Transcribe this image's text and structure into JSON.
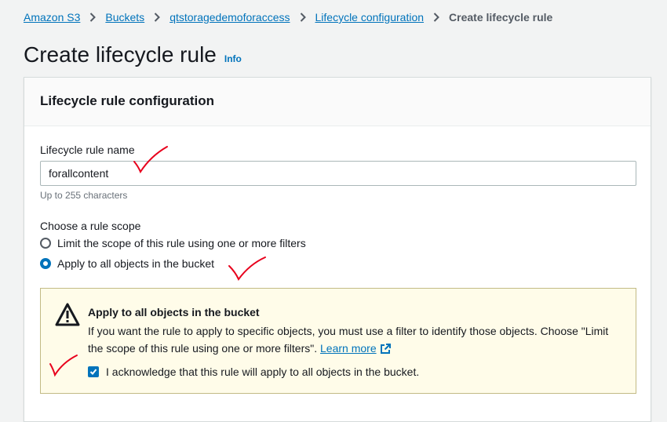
{
  "breadcrumb": {
    "items": [
      "Amazon S3",
      "Buckets",
      "qtstoragedemoforaccess",
      "Lifecycle configuration"
    ],
    "current": "Create lifecycle rule"
  },
  "page": {
    "title": "Create lifecycle rule",
    "info_label": "Info"
  },
  "panel": {
    "title": "Lifecycle rule configuration",
    "rule_name_label": "Lifecycle rule name",
    "rule_name_value": "forallcontent",
    "rule_name_hint": "Up to 255 characters",
    "scope_label": "Choose a rule scope",
    "scope_options": [
      {
        "label": "Limit the scope of this rule using one or more filters",
        "selected": false
      },
      {
        "label": "Apply to all objects in the bucket",
        "selected": true
      }
    ]
  },
  "alert": {
    "title": "Apply to all objects in the bucket",
    "body": "If you want the rule to apply to specific objects, you must use a filter to identify those objects. Choose \"Limit the scope of this rule using one or more filters\".",
    "learn_more": "Learn more",
    "acknowledge_label": "I acknowledge that this rule will apply to all objects in the bucket.",
    "acknowledged": true
  },
  "colors": {
    "link": "#0073bb",
    "warning_bg": "#fffce9",
    "annotation_red": "#e8001c"
  }
}
